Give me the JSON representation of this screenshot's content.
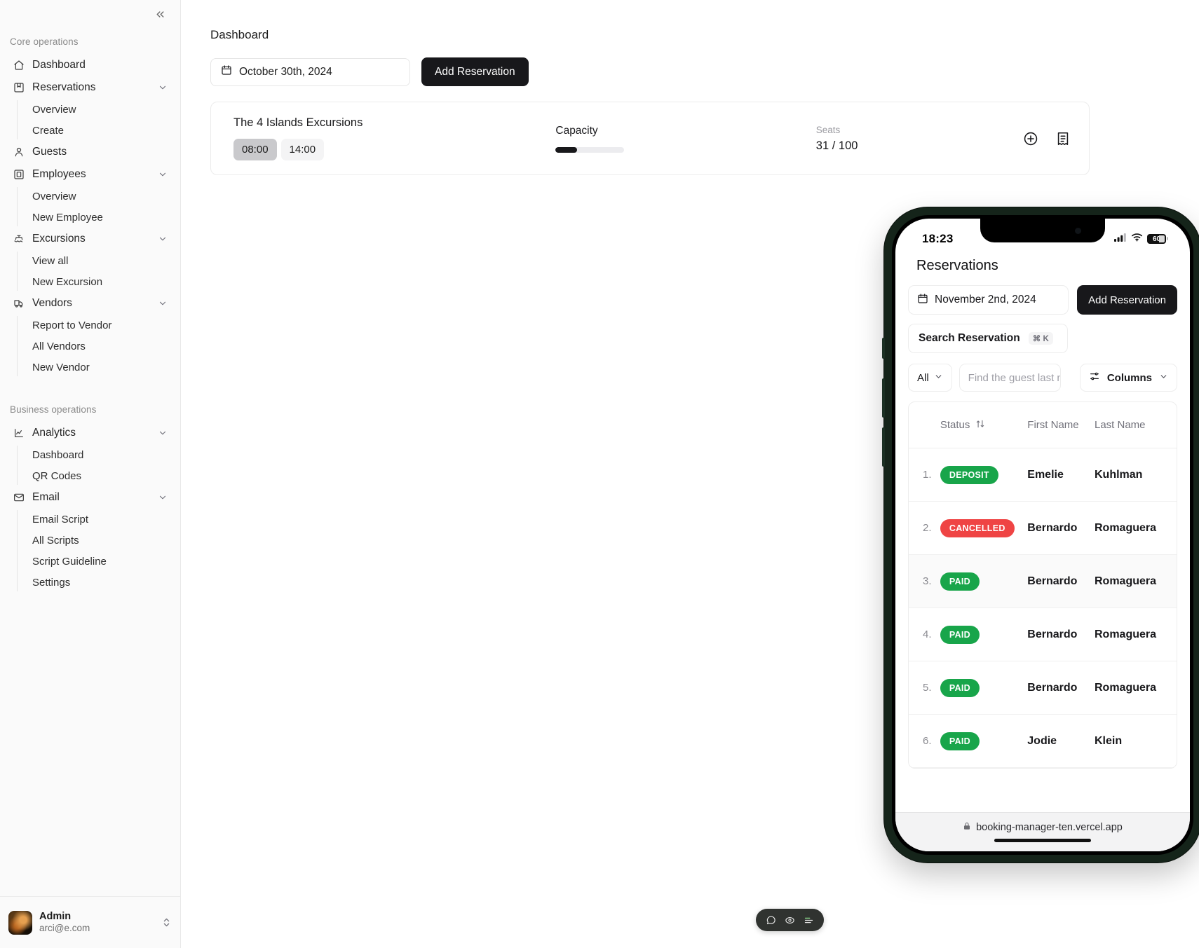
{
  "sidebar": {
    "collapse_icon": "chevrons-left-icon",
    "groups": [
      {
        "label": "Core operations",
        "items": [
          {
            "label": "Dashboard",
            "icon": "home-icon",
            "expandable": false,
            "sub": []
          },
          {
            "label": "Reservations",
            "icon": "bookmark-icon",
            "expandable": true,
            "sub": [
              "Overview",
              "Create"
            ]
          },
          {
            "label": "Guests",
            "icon": "user-icon",
            "expandable": false,
            "sub": []
          },
          {
            "label": "Employees",
            "icon": "id-card-icon",
            "expandable": true,
            "sub": [
              "Overview",
              "New Employee"
            ]
          },
          {
            "label": "Excursions",
            "icon": "boat-icon",
            "expandable": true,
            "sub": [
              "View all",
              "New Excursion"
            ]
          },
          {
            "label": "Vendors",
            "icon": "truck-icon",
            "expandable": true,
            "sub": [
              "Report to Vendor",
              "All Vendors",
              "New Vendor"
            ]
          }
        ]
      },
      {
        "label": "Business operations",
        "items": [
          {
            "label": "Analytics",
            "icon": "chart-line-icon",
            "expandable": true,
            "sub": [
              "Dashboard",
              "QR Codes"
            ]
          },
          {
            "label": "Email",
            "icon": "mail-icon",
            "expandable": true,
            "sub": [
              "Email Script",
              "All Scripts",
              "Script Guideline",
              "Settings"
            ]
          }
        ]
      }
    ],
    "user": {
      "name": "Admin",
      "email": "arci@e.com",
      "avatar": "user-avatar",
      "chevron_icon": "chevrons-up-down-icon"
    }
  },
  "main": {
    "page_title": "Dashboard",
    "date_picker": {
      "value": "October 30th, 2024",
      "icon": "calendar-icon"
    },
    "add_reservation_label": "Add Reservation",
    "card": {
      "excursion_name": "The 4 Islands Excursions",
      "times": [
        {
          "label": "08:00",
          "active": true
        },
        {
          "label": "14:00",
          "active": false
        }
      ],
      "capacity_label": "Capacity",
      "capacity_percent": 31,
      "seats_label": "Seats",
      "seats_value": "31 / 100",
      "actions": [
        {
          "icon": "circle-plus-icon",
          "name": "add-guest-button"
        },
        {
          "icon": "receipt-icon",
          "name": "view-manifest-button"
        }
      ]
    }
  },
  "phone": {
    "frame_color": "#15241a",
    "status_bar": {
      "time": "18:23",
      "cellular_icon": "signal-bars-icon",
      "wifi_icon": "wifi-icon",
      "battery_level": "60"
    },
    "title": "Reservations",
    "date_picker": {
      "value": "November 2nd, 2024",
      "icon": "calendar-icon"
    },
    "add_reservation_label": "Add Reservation",
    "search": {
      "label": "Search Reservation",
      "shortcut": "⌘ K"
    },
    "filter_select": {
      "value": "All",
      "icon": "chevron-down-icon"
    },
    "guest_input": {
      "placeholder": "Find the guest last name"
    },
    "columns_button": {
      "label": "Columns",
      "icon": "sliders-icon",
      "chevron": "chevron-down-icon"
    },
    "table": {
      "headers": [
        "Status",
        "First Name",
        "Last Name"
      ],
      "sort_icon": "arrow-up-down-icon",
      "rows": [
        {
          "index": "1.",
          "status": "DEPOSIT",
          "status_color": "#18a54a",
          "first": "Emelie",
          "last": "Kuhlman",
          "highlight": false
        },
        {
          "index": "2.",
          "status": "CANCELLED",
          "status_color": "#ef4444",
          "first": "Bernardo",
          "last": "Romaguera",
          "highlight": false
        },
        {
          "index": "3.",
          "status": "PAID",
          "status_color": "#18a54a",
          "first": "Bernardo",
          "last": "Romaguera",
          "highlight": true
        },
        {
          "index": "4.",
          "status": "PAID",
          "status_color": "#18a54a",
          "first": "Bernardo",
          "last": "Romaguera",
          "highlight": false
        },
        {
          "index": "5.",
          "status": "PAID",
          "status_color": "#18a54a",
          "first": "Bernardo",
          "last": "Romaguera",
          "highlight": false
        },
        {
          "index": "6.",
          "status": "PAID",
          "status_color": "#18a54a",
          "first": "Jodie",
          "last": "Klein",
          "highlight": false
        }
      ]
    },
    "url_bar": {
      "lock_icon": "lock-icon",
      "url": "booking-manager-ten.vercel.app"
    }
  },
  "float_toolbar": {
    "items": [
      {
        "icon": "message-circle-icon",
        "name": "feedback-button"
      },
      {
        "icon": "eye-target-icon",
        "name": "inspect-button"
      },
      {
        "icon": "menu-lines-icon",
        "name": "menu-button"
      }
    ]
  }
}
